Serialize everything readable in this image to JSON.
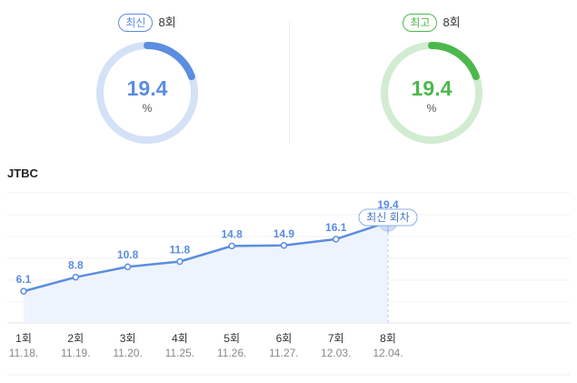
{
  "latest": {
    "badge": "최신",
    "round": "8회",
    "value": "19.4",
    "unit": "%",
    "fraction": 0.194,
    "color": "#5b8de0",
    "track": "#d4e1f7"
  },
  "highest": {
    "badge": "최고",
    "round": "8회",
    "value": "19.4",
    "unit": "%",
    "fraction": 0.194,
    "color": "#4cb84c",
    "track": "#d2ecd2"
  },
  "channel": "JTBC",
  "chart_data": {
    "type": "line",
    "categories": [
      "1회",
      "2회",
      "3회",
      "4회",
      "5회",
      "6회",
      "7회",
      "8회"
    ],
    "dates": [
      "11.18.",
      "11.19.",
      "11.20.",
      "11.25.",
      "11.26.",
      "11.27.",
      "12.03.",
      "12.04."
    ],
    "series": [
      {
        "values": [
          6.1,
          8.8,
          10.8,
          11.8,
          14.8,
          14.9,
          16.1,
          19.4
        ]
      }
    ],
    "ylim": [
      0,
      25
    ],
    "grid": true,
    "annotation": {
      "label": "최신 회차",
      "index": 7
    },
    "line_color": "#5b8de0",
    "fill_color": "#eef4fd"
  }
}
